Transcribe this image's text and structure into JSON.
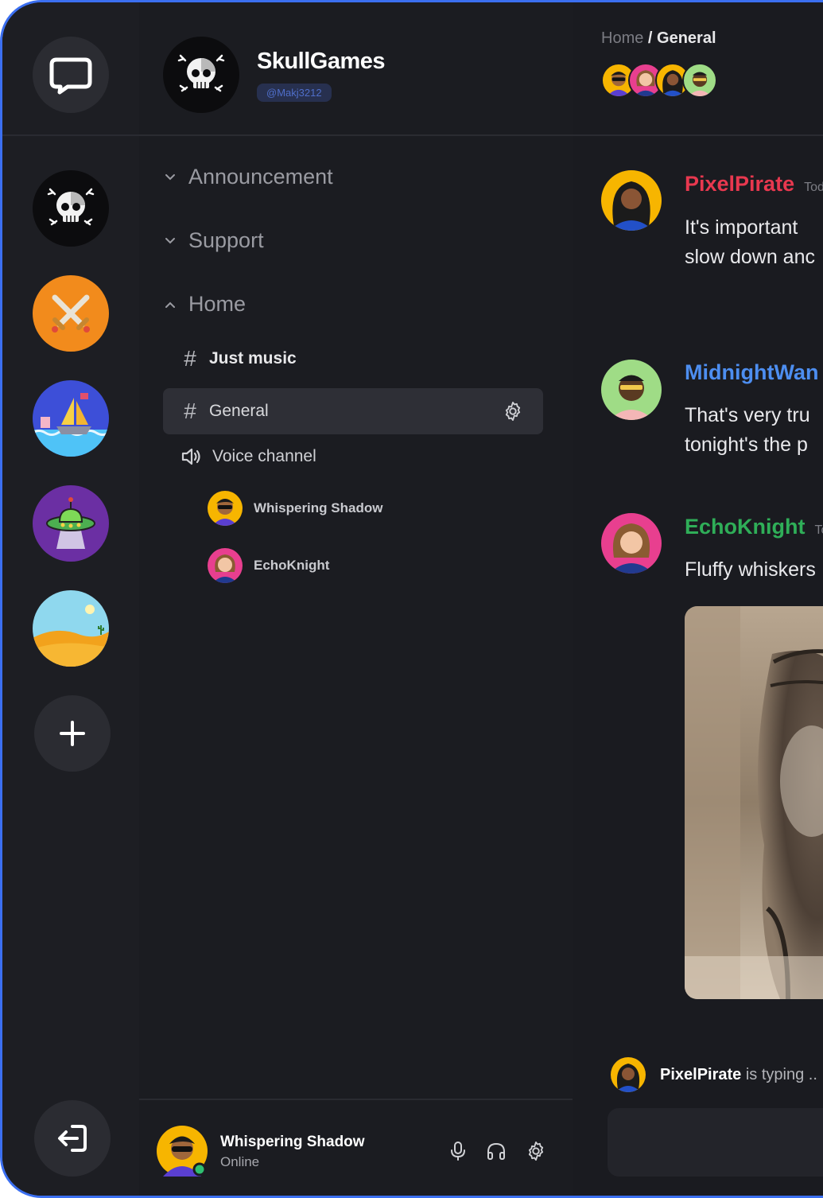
{
  "server": {
    "name": "SkullGames",
    "handle": "@Makj3212"
  },
  "rail": {
    "servers": [
      "skull-server",
      "swords-server",
      "ship-server",
      "ufo-server",
      "desert-server"
    ],
    "add_icon": "plus-icon",
    "logout_icon": "logout-icon",
    "chat_icon": "chat-bubble-icon"
  },
  "channels": {
    "categories": [
      {
        "label": "Announcement",
        "state": "collapsed"
      },
      {
        "label": "Support",
        "state": "collapsed"
      },
      {
        "label": "Home",
        "state": "expanded"
      }
    ],
    "text_channels": [
      {
        "label": "Just music",
        "active": false
      },
      {
        "label": "General",
        "active": true
      }
    ],
    "voice_channel": {
      "label": "Voice channel",
      "users": [
        "Whispering Shadow",
        "EchoKnight"
      ]
    }
  },
  "current_user": {
    "name": "Whispering Shadow",
    "status": "Online"
  },
  "header": {
    "breadcrumb_home": "Home",
    "breadcrumb_sep": " / ",
    "breadcrumb_current": "General"
  },
  "messages": [
    {
      "author": "PixelPirate",
      "time": "Tod",
      "color": "#e8384f",
      "text": "It's important\nslow down anc"
    },
    {
      "author": "MidnightWan",
      "time": "",
      "color": "#4d8ef0",
      "text": "That's very tru\ntonight's the p"
    },
    {
      "author": "EchoKnight",
      "time": "To",
      "color": "#2fae58",
      "text": "Fluffy whiskers"
    }
  ],
  "typing": {
    "user": "PixelPirate",
    "text": "is typing .."
  },
  "colors": {
    "accent": "#3b6ff0",
    "bg": "#1a1b20",
    "panel": "#1b1c21",
    "active_row": "#2e2f36"
  }
}
